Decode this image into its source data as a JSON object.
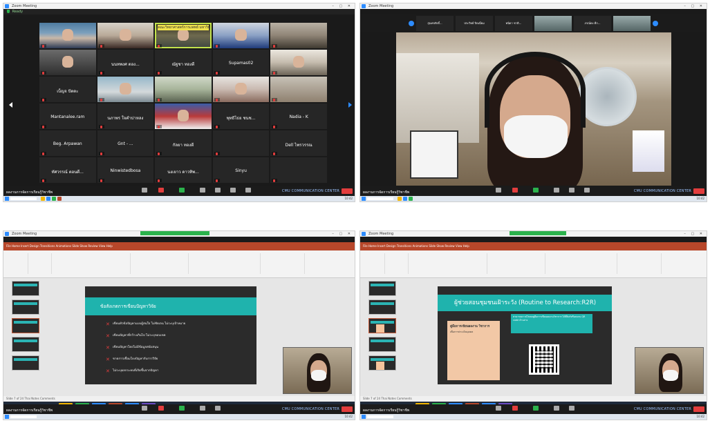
{
  "windows": {
    "zoom_title": "Zoom Meeting",
    "subbar_label": "Ready",
    "window_controls": "– ▢ ✕"
  },
  "gallery": {
    "tiles": [
      {
        "name": "",
        "label": "",
        "style": "v1",
        "face": true
      },
      {
        "name": "",
        "label": "",
        "style": "v2",
        "face": true
      },
      {
        "name": "",
        "label": "",
        "style": "v3",
        "face": true,
        "banner": "คณะวิทยาศาสตร์การแพทย์ มหาวิทยาลัยเชียงใหม่"
      },
      {
        "name": "",
        "label": "",
        "style": "v4",
        "face": true
      },
      {
        "name": "",
        "label": "",
        "style": "v5",
        "face": false
      },
      {
        "name": "",
        "label": "",
        "style": "v6",
        "face": true
      },
      {
        "name": "นนทพงศ ตอง...",
        "label": "",
        "style": "",
        "face": false
      },
      {
        "name": "ณัฐชา ทองดี",
        "label": "",
        "style": "",
        "face": false
      },
      {
        "name": "Supamas02",
        "label": "",
        "style": "",
        "face": false
      },
      {
        "name": "",
        "label": "",
        "style": "v7",
        "face": true
      },
      {
        "name": "เบ็ญจ ปัตตะ",
        "label": "",
        "style": "",
        "face": false
      },
      {
        "name": "",
        "label": "",
        "style": "v8",
        "face": true
      },
      {
        "name": "",
        "label": "",
        "style": "v9",
        "face": false
      },
      {
        "name": "",
        "label": "",
        "style": "v10",
        "face": true
      },
      {
        "name": "",
        "label": "",
        "style": "v12",
        "face": false
      },
      {
        "name": "Mantanalee.ram",
        "label": "",
        "style": "",
        "face": false
      },
      {
        "name": "นภาพร ใจคำปาหลง",
        "label": "",
        "style": "",
        "face": false
      },
      {
        "name": "",
        "label": "",
        "style": "v11",
        "face": true
      },
      {
        "name": "พุทธิไธย ชนช...",
        "label": "",
        "style": "",
        "face": false
      },
      {
        "name": "Nadia - K",
        "label": "",
        "style": "",
        "face": false
      },
      {
        "name": "Beg. Arpawan",
        "label": "",
        "style": "",
        "face": false
      },
      {
        "name": "Gnt - ...",
        "label": "",
        "style": "",
        "face": false
      },
      {
        "name": "กัลยา ทองดี",
        "label": "",
        "style": "",
        "face": false
      },
      {
        "name": "",
        "label": "",
        "style": "",
        "face": false
      },
      {
        "name": "Dell ไพรวรรณ",
        "label": "",
        "style": "",
        "face": false
      },
      {
        "name": "ทัศวรรณ์ ตอนดี...",
        "label": "",
        "style": "",
        "face": false
      },
      {
        "name": "Ninwistedbosa",
        "label": "",
        "style": "",
        "face": false
      },
      {
        "name": "นงเยาว ดาวทิพ...",
        "label": "",
        "style": "",
        "face": false
      },
      {
        "name": "Sinyu",
        "label": "",
        "style": "",
        "face": false
      },
      {
        "name": "",
        "label": "",
        "style": "",
        "face": false
      }
    ]
  },
  "speaker_strip": [
    {
      "name": "สุนทรศักดิ์...",
      "video": false
    },
    {
      "name": "ประวิทย์ ปิดเนี่ยม",
      "video": false
    },
    {
      "name": "พนิดา ชาติ...",
      "video": false
    },
    {
      "name": "",
      "video": true
    },
    {
      "name": "ภรณ์ดง ดีก...",
      "video": false
    },
    {
      "name": "",
      "video": true
    }
  ],
  "zoom_bar": {
    "topic": "ผลงานการจัดการเรียนรู้วิชาชีพ",
    "watermark": "CMU COMMUNICATION CENTER"
  },
  "slides": {
    "slide1_title": "ข้อสังเกตการเขียนปัญหาวิจัย",
    "slide1_bullets": [
      "เขียนหัวข้อปัญหาแบบผู้สนใจ ไม่ชัดเจน ไม่ระบุเป้าหมาย",
      "เขียนปัญหาที่กว้างเกินไป ไม่ระบุขอบเขต",
      "เขียนปัญหาโดยไม่มีข้อมูลสนับสนุน",
      "ขาดการเชื่อมโยงปัญหากับการวิจัย",
      "ไม่ระบุผลกระทบที่เกิดขึ้นจากปัญหา"
    ],
    "slide2_title": "ผู้ช่วยสอนชุมชนเฝ้าระวัง (Routine to Research:R2R)",
    "slide2_book_title": "คู่มือการเขียนผลงาน วิชาการ",
    "slide2_book_sub": "เพื่อการประเมินบุคคล",
    "slide2_info": "สามารถดาวน์โหลดคู่มือการเขียนผลงานวิชาการ ได้ที่ลิงก์หรือสแกน QR code ด้านล่าง"
  },
  "ppt": {
    "ribbon_tabs": "File  Home  Insert  Design  Transitions  Animations  Slide Show  Review  View  Help",
    "status": "Slide 7 of 24   Thai   Notes   Comments"
  },
  "taskbar": {
    "clock": "10:42"
  },
  "colors": {
    "zoom_blue": "#2d8cff",
    "end_red": "#e23d3d",
    "teal": "#1fb3ad",
    "ppt_red": "#b7472a"
  }
}
